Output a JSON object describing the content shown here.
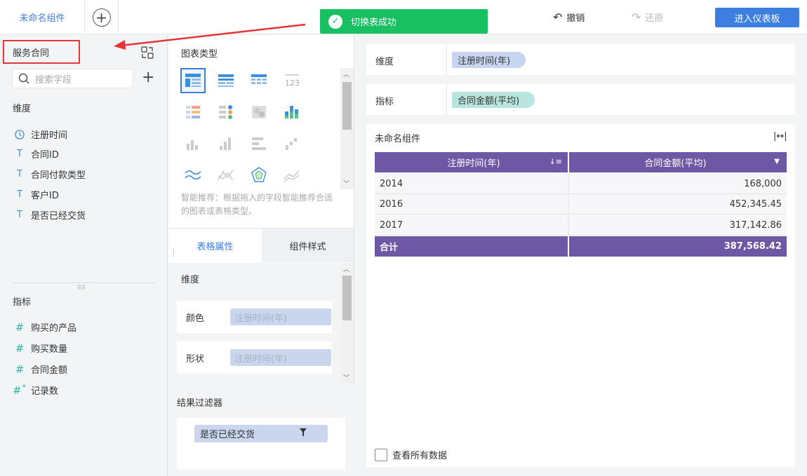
{
  "topbar": {
    "active_tab": "未命名组件",
    "toast": "切换表成功",
    "undo": "撤销",
    "redo": "还原",
    "enter_dashboard": "进入仪表板"
  },
  "left": {
    "datasource": "服务合同",
    "search_placeholder": "搜索字段",
    "dimension_title": "维度",
    "dimensions": [
      "注册时间",
      "合同ID",
      "合同付款类型",
      "客户ID",
      "是否已经交货"
    ],
    "measure_title": "指标",
    "measures": [
      "购买的产品",
      "购买数量",
      "合同金额",
      "记录数"
    ]
  },
  "middle": {
    "chart_type_title": "图表类型",
    "recommend": "智能推荐：根据拖入的字段智能推荐合适的图表或表格类型。",
    "tab_table_props": "表格属性",
    "tab_component_style": "组件样式",
    "prop_dimension_title": "维度",
    "color_label": "颜色",
    "color_value": "注册时间(年)",
    "shape_label": "形状",
    "shape_value": "注册时间(年)",
    "filter_title": "结果过滤器",
    "filter_value": "是否已经交货"
  },
  "right": {
    "dimension_label": "维度",
    "dimension_pill": "注册时间(年)",
    "measure_label": "指标",
    "measure_pill": "合同金额(平均)",
    "widget_title": "未命名组件",
    "table": {
      "headers": [
        "注册时间(年)",
        "合同金额(平均)"
      ],
      "rows": [
        [
          "2014",
          "168,000"
        ],
        [
          "2016",
          "452,345.45"
        ],
        [
          "2017",
          "317,142.86"
        ]
      ],
      "total": [
        "合计",
        "387,568.42"
      ]
    },
    "view_all": "查看所有数据"
  },
  "colors": {
    "accent": "#3d7fe0",
    "header_purple": "#6e58a5",
    "toast_green": "#18c062",
    "highlight_red": "#e53535"
  }
}
